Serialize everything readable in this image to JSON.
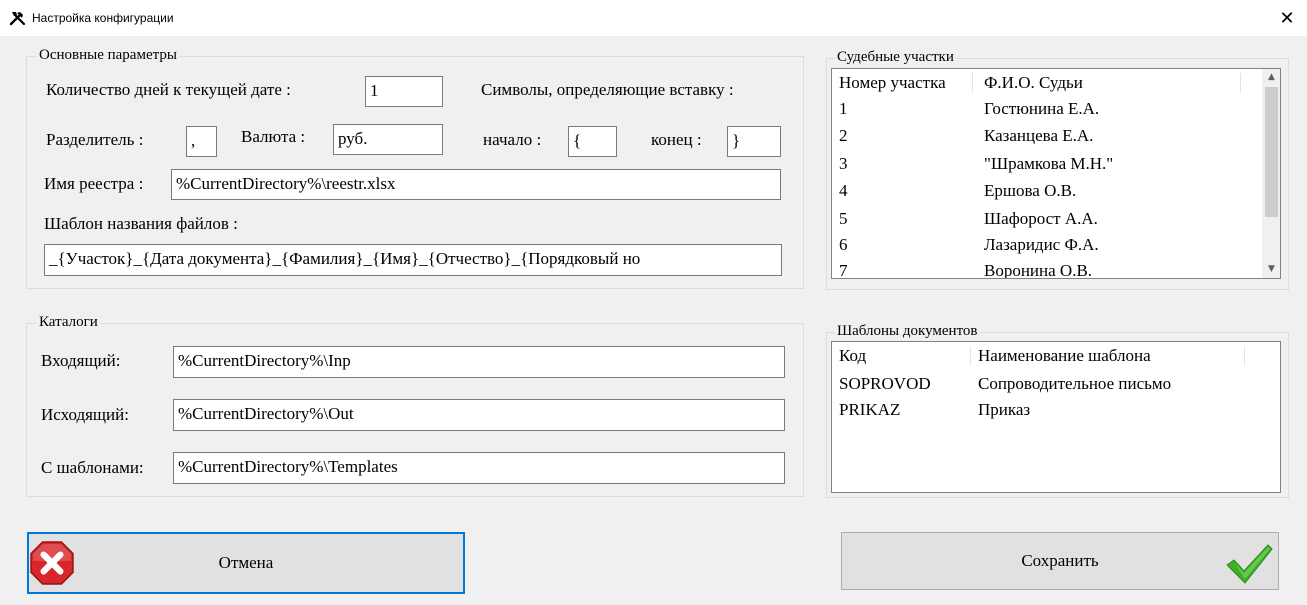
{
  "window": {
    "title": "Настройка конфигурации",
    "close": "✕"
  },
  "main_params": {
    "legend": "Основные параметры",
    "days_label": "Количество дней  к текущей  дате :",
    "days_value": "1",
    "symbols_label": "Символы, определяющие вставку :",
    "separator_label": "Разделитель  :",
    "separator_value": ",",
    "currency_label": "Валюта  :",
    "currency_value": "руб.",
    "start_label": "начало :",
    "start_value": "{",
    "end_label": "конец :",
    "end_value": "}",
    "registry_label": "Имя реестра :",
    "registry_value": "%CurrentDirectory%\\reestr.xlsx",
    "template_label": "Шаблон названия файлов :",
    "template_value": "_{Участок}_{Дата документа}_{Фамилия}_{Имя}_{Отчество}_{Порядковый но"
  },
  "catalogs": {
    "legend": "Каталоги",
    "incoming_label": "Входящий:",
    "incoming_value": "%CurrentDirectory%\\Inp",
    "outgoing_label": "Исходящий:",
    "outgoing_value": "%CurrentDirectory%\\Out",
    "templates_label": "С шаблонами:",
    "templates_value": "%CurrentDirectory%\\Templates"
  },
  "courts": {
    "legend": "Судебные участки",
    "columns": [
      "Номер участка",
      "Ф.И.О. Судьи"
    ],
    "rows": [
      [
        "1",
        "Гостюнина Е.А."
      ],
      [
        "2",
        "Казанцева Е.А."
      ],
      [
        "3",
        "\"Шрамкова М.Н.\""
      ],
      [
        "4",
        "Ершова  О.В."
      ],
      [
        "5",
        "Шафорост А.А."
      ],
      [
        "6",
        "Лазаридис Ф.А."
      ],
      [
        "7",
        "Воронина О.В."
      ]
    ]
  },
  "doc_templates": {
    "legend": "Шаблоны документов",
    "columns": [
      "Код",
      "Наименование шаблона"
    ],
    "rows": [
      [
        "SOPROVOD",
        "Сопроводительное письмо"
      ],
      [
        "PRIKAZ",
        "Приказ"
      ]
    ]
  },
  "buttons": {
    "cancel": "Отмена",
    "save": "Сохранить"
  },
  "icons": {
    "app": "tools-icon",
    "cancel": "error-x-icon",
    "save": "checkmark-icon"
  },
  "colors": {
    "focus": "#0078d7",
    "cancel_red": "#d9262b",
    "save_green": "#3fae29"
  }
}
